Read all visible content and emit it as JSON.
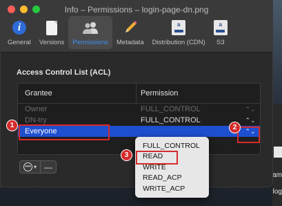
{
  "window": {
    "title": "Info – Permissions – login-page-dn.png"
  },
  "toolbar": {
    "items": [
      {
        "label": "General",
        "icon": "info-icon"
      },
      {
        "label": "Versions",
        "icon": "document-icon"
      },
      {
        "label": "Permissions",
        "icon": "users-icon",
        "active": true
      },
      {
        "label": "Metadata",
        "icon": "pencil-icon"
      },
      {
        "label": "Distribution (CDN)",
        "icon": "amazon-icon"
      },
      {
        "label": "S3",
        "icon": "amazon-icon"
      }
    ]
  },
  "acl": {
    "title": "Access Control List (ACL)",
    "columns": {
      "grantee": "Grantee",
      "permission": "Permission"
    },
    "rows": [
      {
        "grantee": "Owner",
        "permission": "FULL_CONTROL"
      },
      {
        "grantee": "DN-try",
        "permission": "FULL_CONTROL"
      },
      {
        "grantee": "Everyone",
        "permission": ""
      }
    ]
  },
  "buttons": {
    "more": "⋯ ▾",
    "remove": "—"
  },
  "menu": {
    "options": [
      "FULL_CONTROL",
      "READ",
      "WRITE",
      "READ_ACP",
      "WRITE_ACP"
    ]
  },
  "annotations": {
    "step1": "1",
    "step2": "2",
    "step3": "3",
    "color": "#d52b2b"
  },
  "background": {
    "text1": "am",
    "text2": "log"
  }
}
